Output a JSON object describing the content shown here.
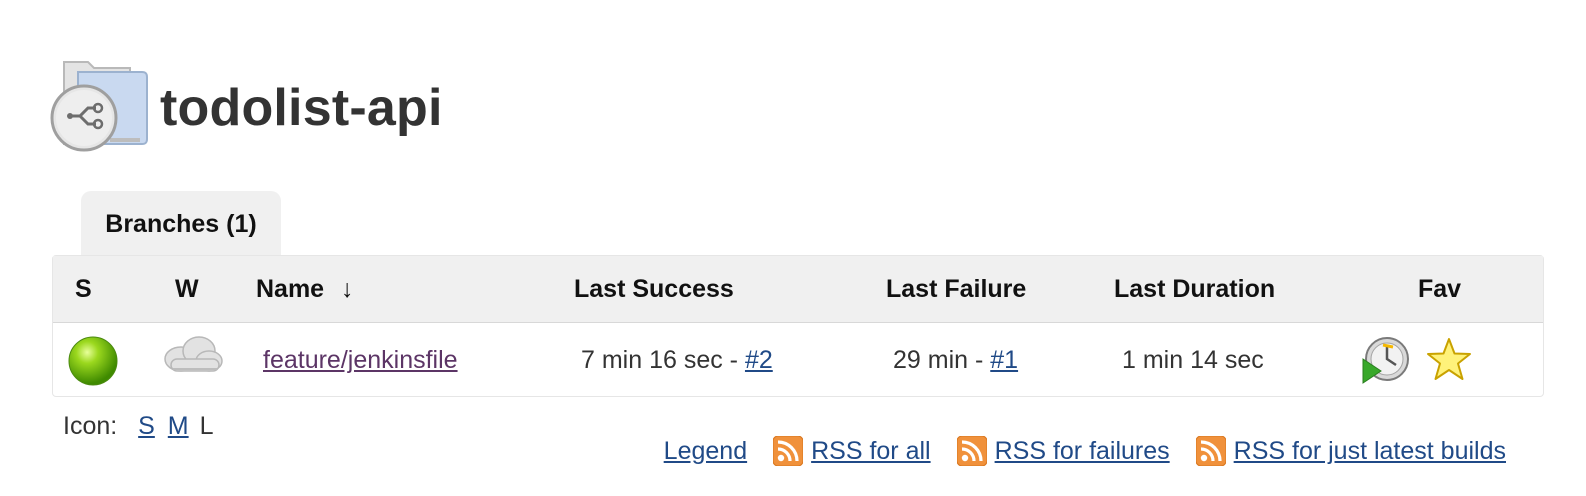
{
  "project": {
    "title": "todolist-api",
    "icon": "multibranch-folder-icon"
  },
  "tabs": [
    {
      "label": "Branches (1)"
    }
  ],
  "table": {
    "headers": {
      "s": "S",
      "w": "W",
      "name": "Name",
      "name_sort": "↓",
      "last_success": "Last Success",
      "last_failure": "Last Failure",
      "last_duration": "Last Duration",
      "fav": "Fav"
    },
    "rows": [
      {
        "status_icon": "green-ball-icon",
        "weather_icon": "cloudy-icon",
        "name": "feature/jenkinsfile",
        "last_success_text": "7 min 16 sec - ",
        "last_success_build": "#2",
        "last_failure_text": "29 min - ",
        "last_failure_build": "#1",
        "last_duration": "1 min 14 sec",
        "schedule_icon": "schedule-build-icon",
        "fav_icon": "star-icon"
      }
    ]
  },
  "icon_size": {
    "label": "Icon:",
    "s": "S",
    "m": "M",
    "l": "L"
  },
  "footer": {
    "legend": "Legend",
    "rss_all": "RSS for all",
    "rss_failures": "RSS for failures",
    "rss_latest": "RSS for just latest builds"
  },
  "colors": {
    "link": "#204a87",
    "visited_link": "#5c3566",
    "header_bg": "#f0f0f0",
    "rss": "#f0913b"
  }
}
